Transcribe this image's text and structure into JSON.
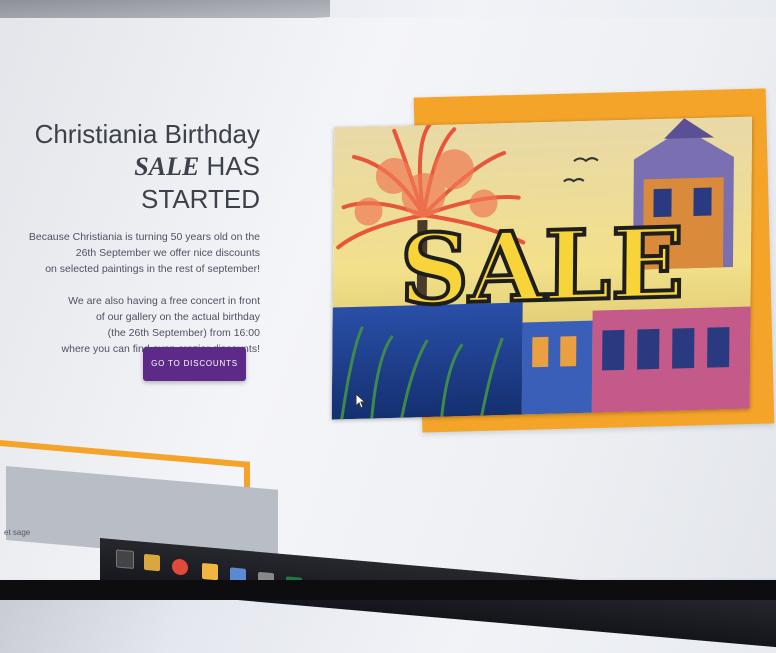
{
  "hero": {
    "title_line1": "Christiania Birthday",
    "title_sale_word": "SALE",
    "title_line2_rest": " HAS STARTED",
    "paragraph1": [
      "Because Christiania is turning 50 years old on the",
      "26th September we offer nice discounts",
      "on selected paintings in the rest of september!"
    ],
    "paragraph2": [
      "We are also having a free concert in front",
      "of our gallery on the actual birthday",
      "(the 26th September) from 16:00",
      "where you can find even crazier discounts!"
    ],
    "cta_label": "GO TO DISCOUNTS"
  },
  "image": {
    "sale_text": "SALE"
  },
  "footer": {
    "partial_text": "et sage"
  },
  "taskbar": {
    "icons": [
      "task-view-icon",
      "file-explorer-icon",
      "chrome-icon",
      "folder-icon",
      "network-icon",
      "app-icon",
      "excel-icon"
    ]
  },
  "colors": {
    "accent_orange": "#f4a429",
    "button_purple": "#5d2a8a",
    "heading_gray": "#3d414c"
  }
}
